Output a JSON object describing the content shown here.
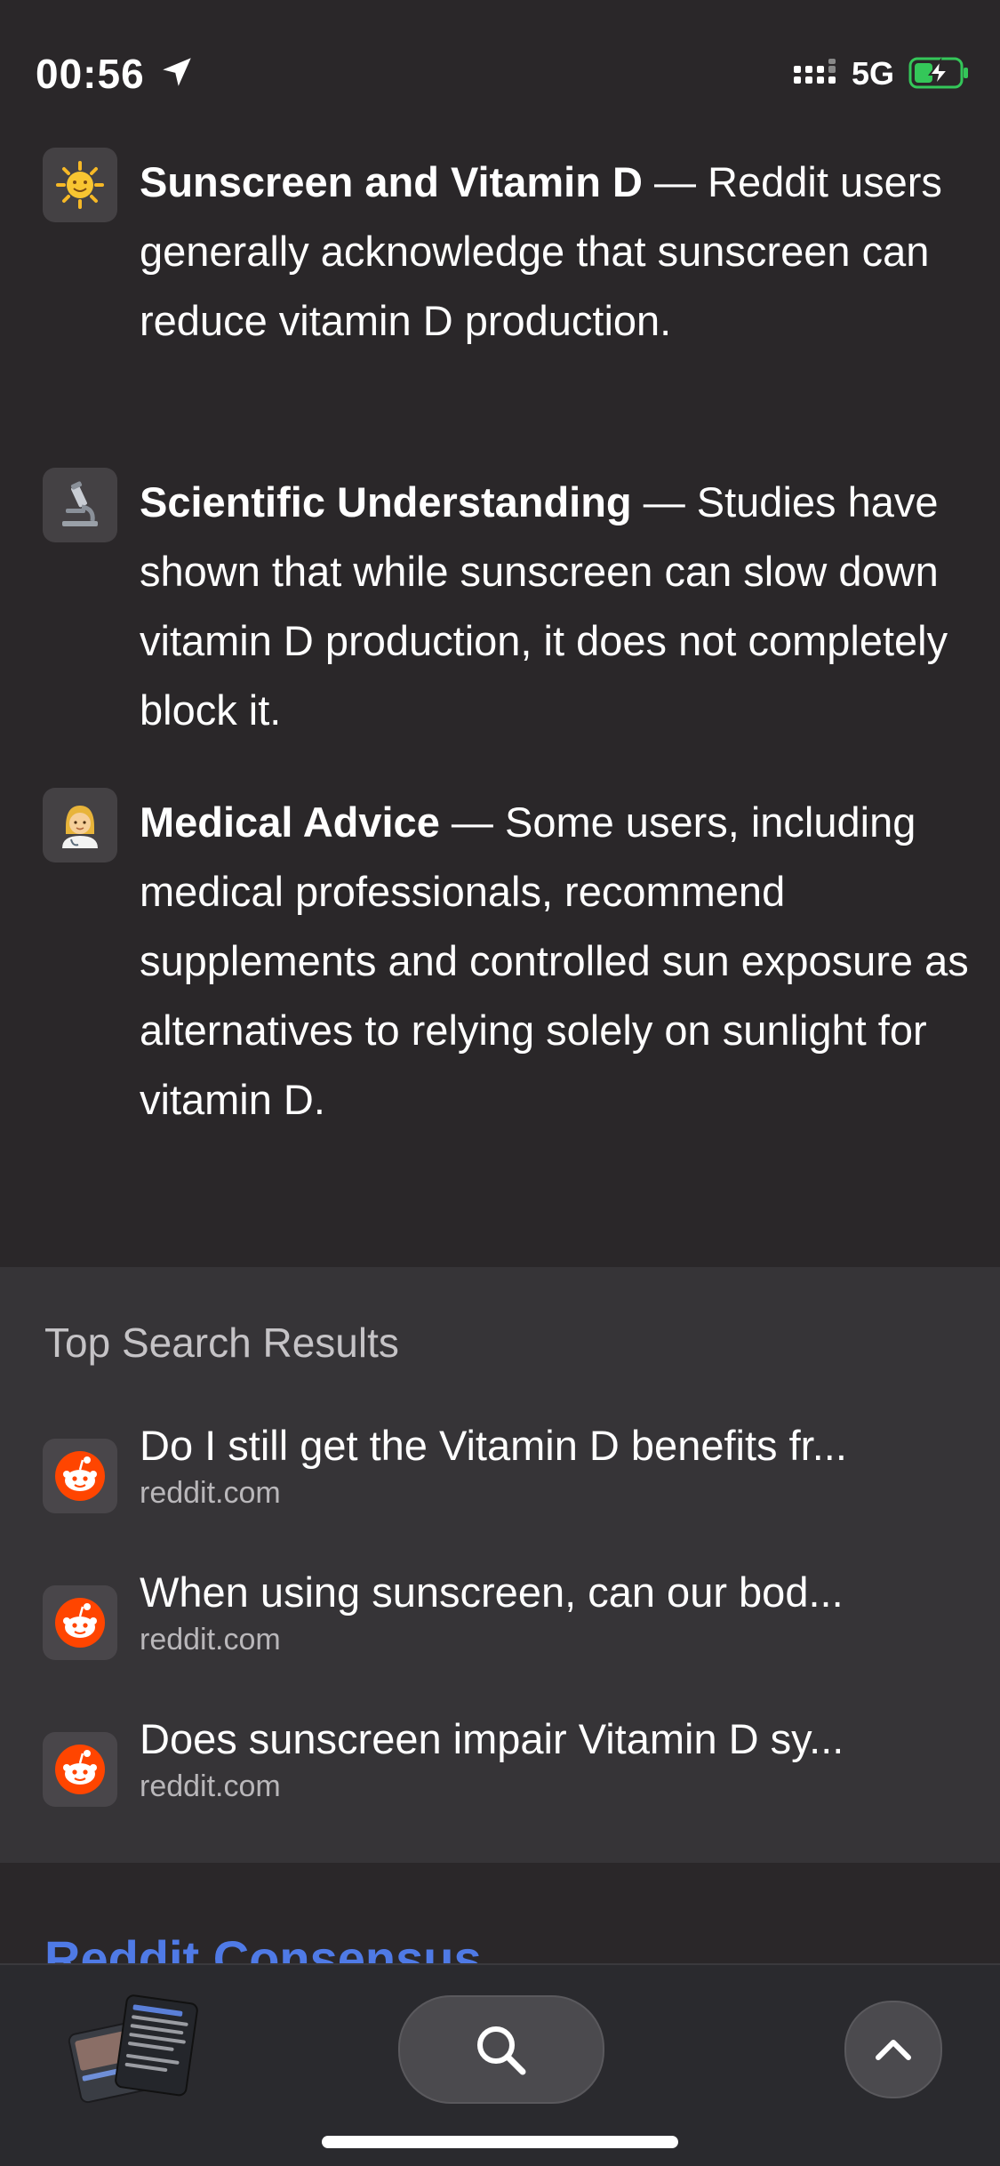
{
  "status_bar": {
    "time": "00:56",
    "network": "5G",
    "icons": [
      "location-arrow-icon",
      "signal-bars-icon",
      "battery-charging-icon"
    ]
  },
  "summary_items": [
    {
      "icon": "sun-emoji-icon",
      "title": "Sunscreen and Vitamin D",
      "separator": " — ",
      "body": "Reddit users generally acknowledge that sunscreen can reduce vitamin D production."
    },
    {
      "icon": "microscope-emoji-icon",
      "title": "Scientific Understanding",
      "separator": " — ",
      "body": "Studies have shown that while sunscreen can slow down vitamin D production, it does not completely block it."
    },
    {
      "icon": "health-worker-emoji-icon",
      "title": "Medical Advice",
      "separator": " — ",
      "body": "Some users, including medical professionals, recommend supplements and controlled sun exposure as alternatives to relying solely on sunlight for vitamin D."
    }
  ],
  "top_results": {
    "heading": "Top Search Results",
    "items": [
      {
        "icon": "reddit-icon",
        "title": "Do I still get the Vitamin D benefits fr...",
        "domain": "reddit.com"
      },
      {
        "icon": "reddit-icon",
        "title": "When using sunscreen, can our bod...",
        "domain": "reddit.com"
      },
      {
        "icon": "reddit-icon",
        "title": "Does sunscreen impair Vitamin D sy...",
        "domain": "reddit.com"
      }
    ]
  },
  "next_section": {
    "title": "Reddit Consensus"
  },
  "toolbar": {
    "icons": [
      "tabs-thumbnail",
      "search-icon",
      "chevron-up-icon"
    ]
  },
  "colors": {
    "background": "#2a2729",
    "results_panel": "#363437",
    "accent_link": "#4f7ae6",
    "reddit_orange": "#ff4500"
  }
}
